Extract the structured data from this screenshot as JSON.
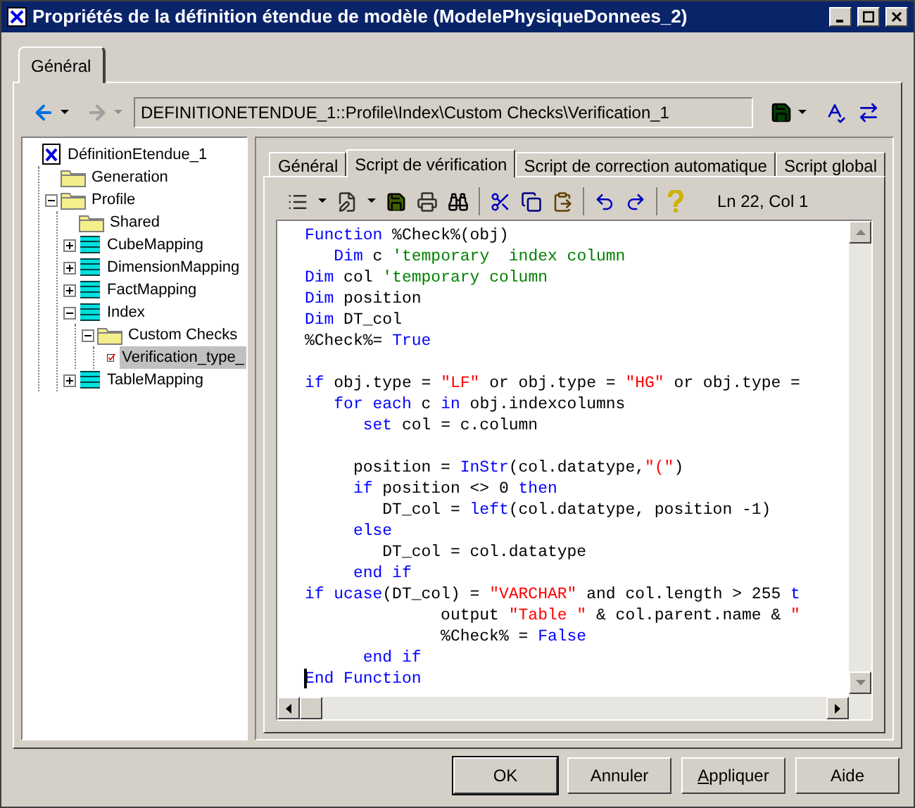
{
  "window": {
    "title": "Propriétés de la définition étendue de modèle (ModelePhysiqueDonnees_2)"
  },
  "tabs": [
    {
      "label": "Général",
      "selected": true
    }
  ],
  "navigation": {
    "back_enabled": true,
    "forward_enabled": false
  },
  "path_field": {
    "value": "DEFINITIONETENDUE_1::Profile\\Index\\Custom Checks\\Verification_1"
  },
  "tree": [
    {
      "label": "DéfinitionEtendue_1",
      "kind": "root",
      "selected": false,
      "children": [
        {
          "label": "Generation",
          "kind": "folder",
          "selected": false
        },
        {
          "label": "Profile",
          "kind": "folder",
          "expanded": true,
          "selected": false,
          "children": [
            {
              "label": "Shared",
              "kind": "folder",
              "selected": false
            },
            {
              "label": "CubeMapping",
              "kind": "category",
              "expanded": false,
              "selected": false
            },
            {
              "label": "DimensionMapping",
              "kind": "category",
              "expanded": false,
              "selected": false
            },
            {
              "label": "FactMapping",
              "kind": "category",
              "expanded": false,
              "selected": false
            },
            {
              "label": "Index",
              "kind": "category",
              "expanded": true,
              "selected": false,
              "children": [
                {
                  "label": "Custom Checks",
                  "kind": "folder",
                  "expanded": true,
                  "selected": false,
                  "children": [
                    {
                      "label": "Verification_type_",
                      "kind": "check",
                      "selected": true
                    }
                  ]
                }
              ]
            },
            {
              "label": "TableMapping",
              "kind": "category",
              "expanded": false,
              "selected": false
            }
          ]
        }
      ]
    }
  ],
  "inner_tabs": [
    {
      "label": "Général",
      "selected": false
    },
    {
      "label": "Script de vérification",
      "selected": true
    },
    {
      "label": "Script de correction automatique",
      "selected": false
    },
    {
      "label": "Script global",
      "selected": false
    }
  ],
  "editor_toolbar": {
    "position": "Ln 22, Col 1"
  },
  "code": [
    {
      "tokens": [
        {
          "text": "Function",
          "kind": "kw"
        },
        {
          "text": " %Check%(obj)",
          "kind": "plain"
        }
      ]
    },
    {
      "tokens": [
        {
          "text": "   Dim",
          "kind": "kw"
        },
        {
          "text": " c ",
          "kind": "plain"
        },
        {
          "text": "'temporary  index column",
          "kind": "comment"
        }
      ]
    },
    {
      "tokens": [
        {
          "text": "Dim",
          "kind": "kw"
        },
        {
          "text": " col ",
          "kind": "plain"
        },
        {
          "text": "'temporary column",
          "kind": "comment"
        }
      ]
    },
    {
      "tokens": [
        {
          "text": "Dim",
          "kind": "kw"
        },
        {
          "text": " position",
          "kind": "plain"
        }
      ]
    },
    {
      "tokens": [
        {
          "text": "Dim",
          "kind": "kw"
        },
        {
          "text": " DT_col",
          "kind": "plain"
        }
      ]
    },
    {
      "tokens": [
        {
          "text": "%Check%= ",
          "kind": "plain"
        },
        {
          "text": "True",
          "kind": "kw"
        }
      ]
    },
    {
      "blank": true
    },
    {
      "tokens": [
        {
          "text": "if",
          "kind": "kw"
        },
        {
          "text": " obj.type = ",
          "kind": "plain"
        },
        {
          "text": "\"LF\"",
          "kind": "str"
        },
        {
          "text": " or obj.type = ",
          "kind": "plain"
        },
        {
          "text": "\"HG\"",
          "kind": "str"
        },
        {
          "text": " or obj.type =",
          "kind": "plain"
        }
      ]
    },
    {
      "tokens": [
        {
          "text": "   for each",
          "kind": "kw"
        },
        {
          "text": " c ",
          "kind": "plain"
        },
        {
          "text": "in",
          "kind": "kw"
        },
        {
          "text": " obj.indexcolumns",
          "kind": "plain"
        }
      ]
    },
    {
      "tokens": [
        {
          "text": "      set",
          "kind": "kw"
        },
        {
          "text": " col = c.column",
          "kind": "plain"
        }
      ]
    },
    {
      "blank": true
    },
    {
      "tokens": [
        {
          "text": "     position = ",
          "kind": "plain"
        },
        {
          "text": "InStr",
          "kind": "kw"
        },
        {
          "text": "(col.datatype,",
          "kind": "plain"
        },
        {
          "text": "\"(\"",
          "kind": "str"
        },
        {
          "text": ")",
          "kind": "plain"
        }
      ]
    },
    {
      "tokens": [
        {
          "text": "     if",
          "kind": "kw"
        },
        {
          "text": " position <> 0 ",
          "kind": "plain"
        },
        {
          "text": "then",
          "kind": "kw"
        }
      ]
    },
    {
      "tokens": [
        {
          "text": "        DT_col = ",
          "kind": "plain"
        },
        {
          "text": "left",
          "kind": "kw"
        },
        {
          "text": "(col.datatype, position -1)",
          "kind": "plain"
        }
      ]
    },
    {
      "tokens": [
        {
          "text": "     else",
          "kind": "kw"
        }
      ]
    },
    {
      "tokens": [
        {
          "text": "        DT_col = col.datatype",
          "kind": "plain"
        }
      ]
    },
    {
      "tokens": [
        {
          "text": "     end if",
          "kind": "kw"
        }
      ]
    },
    {
      "tokens": [
        {
          "text": "if ucase",
          "kind": "kw"
        },
        {
          "text": "(DT_col) = ",
          "kind": "plain"
        },
        {
          "text": "\"VARCHAR\"",
          "kind": "str"
        },
        {
          "text": " and col.length > 255 ",
          "kind": "plain"
        },
        {
          "text": "t",
          "kind": "kw"
        }
      ]
    },
    {
      "tokens": [
        {
          "text": "              output ",
          "kind": "plain"
        },
        {
          "text": "\"Table \"",
          "kind": "str"
        },
        {
          "text": " & col.parent.name & ",
          "kind": "plain"
        },
        {
          "text": "\"",
          "kind": "str"
        }
      ]
    },
    {
      "tokens": [
        {
          "text": "              %Check% = ",
          "kind": "plain"
        },
        {
          "text": "False",
          "kind": "kw"
        }
      ]
    },
    {
      "tokens": [
        {
          "text": "      end if",
          "kind": "kw"
        }
      ]
    },
    {
      "cursor": true,
      "tokens": [
        {
          "text": "End Function",
          "kind": "kw"
        }
      ]
    }
  ],
  "buttons": [
    {
      "label": "OK",
      "kind": "default"
    },
    {
      "label": "Annuler",
      "kind": "normal"
    },
    {
      "label": "Appliquer",
      "kind": "normal",
      "mnemonic_underlined": true
    },
    {
      "label": "Aide",
      "kind": "normal"
    }
  ]
}
